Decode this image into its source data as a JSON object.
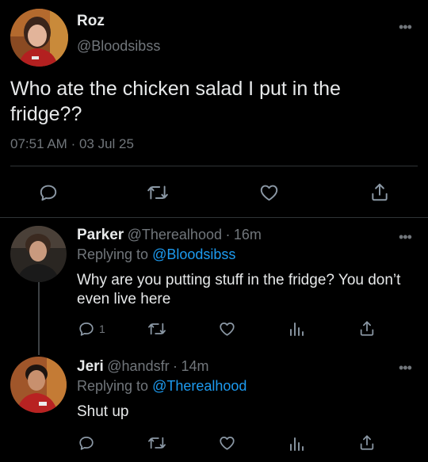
{
  "main_tweet": {
    "author_name": "Roz",
    "author_handle": "@Bloodsibss",
    "text": "Who ate the chicken salad I put in the fridge??",
    "time": "07:51 AM",
    "date_sep": "·",
    "date": "03 Jul 25",
    "more_label": "•••"
  },
  "replies": [
    {
      "author_name": "Parker",
      "author_handle": "@Therealhood",
      "sep": "·",
      "age": "16m",
      "replying_prefix": "Replying to",
      "replying_to": "@Bloodsibss",
      "text": "Why are you putting stuff in the fridge? You don’t even live here",
      "reply_count": "1",
      "more_label": "•••"
    },
    {
      "author_name": "Jeri",
      "author_handle": "@handsfr",
      "sep": "·",
      "age": "14m",
      "replying_prefix": "Replying to",
      "replying_to": "@Therealhood",
      "text": "Shut up",
      "more_label": "•••"
    }
  ],
  "colors": {
    "background": "#000000",
    "text": "#e7e9ea",
    "muted": "#71767b",
    "link": "#1d9bf0",
    "divider": "#2f3336"
  },
  "icons": [
    "reply-icon",
    "retweet-icon",
    "like-icon",
    "views-icon",
    "share-icon",
    "more-icon"
  ]
}
